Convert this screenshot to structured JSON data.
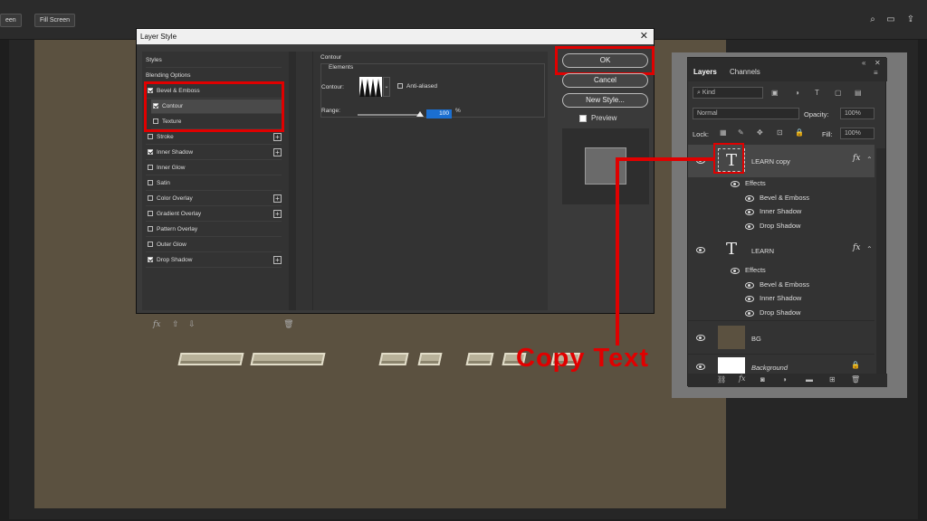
{
  "topbar": {
    "partial_button": "een",
    "fill_screen_button": "Fill Screen"
  },
  "dialog": {
    "title": "Layer Style",
    "styles_items": [
      {
        "label": "Styles",
        "checkbox": false
      },
      {
        "label": "Blending Options",
        "checkbox": false
      },
      {
        "label": "Bevel & Emboss",
        "checkbox": true,
        "checked": true
      },
      {
        "label": "Contour",
        "checkbox": true,
        "checked": true
      },
      {
        "label": "Texture",
        "checkbox": true,
        "checked": false
      },
      {
        "label": "Stroke",
        "checkbox": true,
        "checked": false,
        "plus": true
      },
      {
        "label": "Inner Shadow",
        "checkbox": true,
        "checked": true,
        "plus": true
      },
      {
        "label": "Inner Glow",
        "checkbox": true,
        "checked": false
      },
      {
        "label": "Satin",
        "checkbox": true,
        "checked": false
      },
      {
        "label": "Color Overlay",
        "checkbox": true,
        "checked": false,
        "plus": true
      },
      {
        "label": "Gradient Overlay",
        "checkbox": true,
        "checked": false,
        "plus": true
      },
      {
        "label": "Pattern Overlay",
        "checkbox": true,
        "checked": false
      },
      {
        "label": "Outer Glow",
        "checkbox": true,
        "checked": false
      },
      {
        "label": "Drop Shadow",
        "checkbox": true,
        "checked": true,
        "plus": true
      }
    ],
    "footer_fx": "fx",
    "contour": {
      "section_title": "Contour",
      "group_title": "Elements",
      "contour_label": "Contour:",
      "anti_aliased_label": "Anti-aliased",
      "range_label": "Range:",
      "range_value": "100",
      "range_unit": "%"
    },
    "buttons": {
      "ok": "OK",
      "cancel": "Cancel",
      "new_style": "New Style...",
      "preview": "Preview"
    }
  },
  "layers": {
    "tabs": [
      "Layers",
      "Channels"
    ],
    "kind_label": "Kind",
    "blend_mode": "Normal",
    "opacity_label": "Opacity:",
    "opacity_value": "100%",
    "lock_label": "Lock:",
    "fill_label": "Fill:",
    "fill_value": "100%",
    "rows": [
      {
        "name": "LEARN copy",
        "type": "text",
        "fx": "fx"
      },
      {
        "name": "Effects",
        "type": "effects-header"
      },
      {
        "name": "Bevel & Emboss",
        "type": "effect"
      },
      {
        "name": "Inner Shadow",
        "type": "effect"
      },
      {
        "name": "Drop Shadow",
        "type": "effect"
      },
      {
        "name": "LEARN",
        "type": "text",
        "fx": "fx"
      },
      {
        "name": "Effects",
        "type": "effects-header"
      },
      {
        "name": "Bevel & Emboss",
        "type": "effect"
      },
      {
        "name": "Inner Shadow",
        "type": "effect"
      },
      {
        "name": "Drop Shadow",
        "type": "effect"
      },
      {
        "name": "BG",
        "type": "fill"
      },
      {
        "name": "Background",
        "type": "background"
      }
    ],
    "text_thumb_glyph": "T"
  },
  "annotation": {
    "text": "Copy Text"
  },
  "colors": {
    "accent_red": "#e00000",
    "canvas": "#5b5140",
    "selection_blue": "#1b6fd1"
  }
}
